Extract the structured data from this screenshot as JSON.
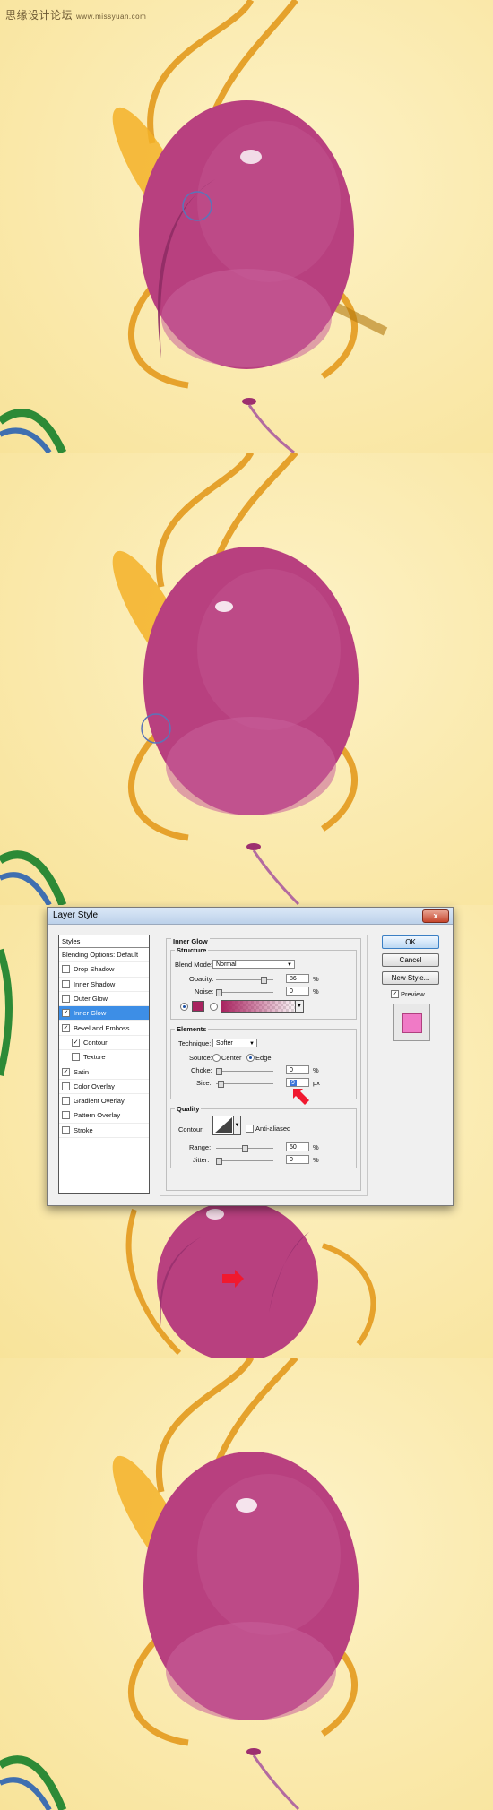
{
  "watermark": {
    "text": "思缘设计论坛",
    "url": "www.missyuan.com"
  },
  "dialog": {
    "title": "Layer Style",
    "close": "x",
    "styles_header": "Styles",
    "styles_list": [
      {
        "label": "Blending Options: Default",
        "checkbox": false,
        "checked": false,
        "selected": false,
        "indent": false
      },
      {
        "label": "Drop Shadow",
        "checkbox": true,
        "checked": false,
        "selected": false,
        "indent": false
      },
      {
        "label": "Inner Shadow",
        "checkbox": true,
        "checked": false,
        "selected": false,
        "indent": false
      },
      {
        "label": "Outer Glow",
        "checkbox": true,
        "checked": false,
        "selected": false,
        "indent": false
      },
      {
        "label": "Inner Glow",
        "checkbox": true,
        "checked": true,
        "selected": true,
        "indent": false
      },
      {
        "label": "Bevel and Emboss",
        "checkbox": true,
        "checked": true,
        "selected": false,
        "indent": false
      },
      {
        "label": "Contour",
        "checkbox": true,
        "checked": true,
        "selected": false,
        "indent": true
      },
      {
        "label": "Texture",
        "checkbox": true,
        "checked": false,
        "selected": false,
        "indent": true
      },
      {
        "label": "Satin",
        "checkbox": true,
        "checked": true,
        "selected": false,
        "indent": false
      },
      {
        "label": "Color Overlay",
        "checkbox": true,
        "checked": false,
        "selected": false,
        "indent": false
      },
      {
        "label": "Gradient Overlay",
        "checkbox": true,
        "checked": false,
        "selected": false,
        "indent": false
      },
      {
        "label": "Pattern Overlay",
        "checkbox": true,
        "checked": false,
        "selected": false,
        "indent": false
      },
      {
        "label": "Stroke",
        "checkbox": true,
        "checked": false,
        "selected": false,
        "indent": false
      }
    ],
    "section_title": "Inner Glow",
    "structure": {
      "title": "Structure",
      "blend_mode_label": "Blend Mode:",
      "blend_mode_value": "Normal",
      "opacity_label": "Opacity:",
      "opacity_value": "86",
      "opacity_unit": "%",
      "opacity_fraction": 0.86,
      "noise_label": "Noise:",
      "noise_value": "0",
      "noise_unit": "%",
      "noise_fraction": 0,
      "glow_color": "#a8235f"
    },
    "elements": {
      "title": "Elements",
      "technique_label": "Technique:",
      "technique_value": "Softer",
      "source_label": "Source:",
      "source_center": "Center",
      "source_edge": "Edge",
      "choke_label": "Choke:",
      "choke_value": "0",
      "choke_unit": "%",
      "choke_fraction": 0,
      "size_label": "Size:",
      "size_value": "9",
      "size_unit": "px",
      "size_fraction": 0.04
    },
    "quality": {
      "title": "Quality",
      "contour_label": "Contour:",
      "anti_aliased_label": "Anti-aliased",
      "range_label": "Range:",
      "range_value": "50",
      "range_unit": "%",
      "range_fraction": 0.5,
      "jitter_label": "Jitter:",
      "jitter_value": "0",
      "jitter_unit": "%",
      "jitter_fraction": 0
    },
    "buttons": {
      "ok": "OK",
      "cancel": "Cancel",
      "new_style": "New Style...",
      "preview": "Preview"
    },
    "preview_color": "#f07ac6"
  },
  "colors": {
    "background": "#fbecab",
    "balloon": "#b8407f",
    "accent": "#f0192f"
  }
}
